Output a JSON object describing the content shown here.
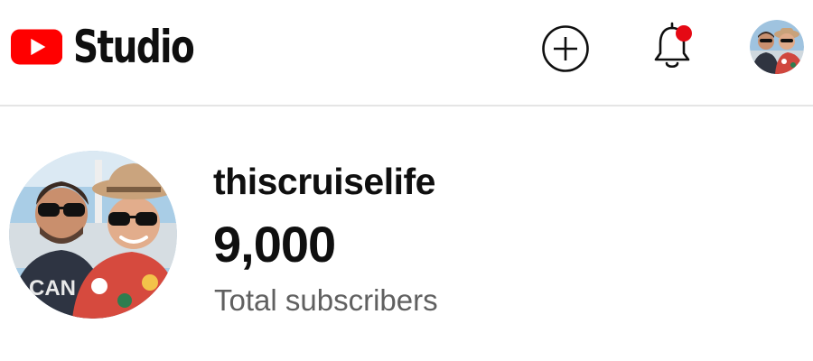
{
  "header": {
    "logo_text": "Studio",
    "brand_color": "#ff0000",
    "create_icon": "add-circle-icon",
    "notifications_icon": "bell-icon",
    "notification_dot_color": "#e50914",
    "account_icon": "account-avatar"
  },
  "channel": {
    "name": "thiscruiselife",
    "subscriber_count": "9,000",
    "subscriber_label": "Total subscribers"
  }
}
